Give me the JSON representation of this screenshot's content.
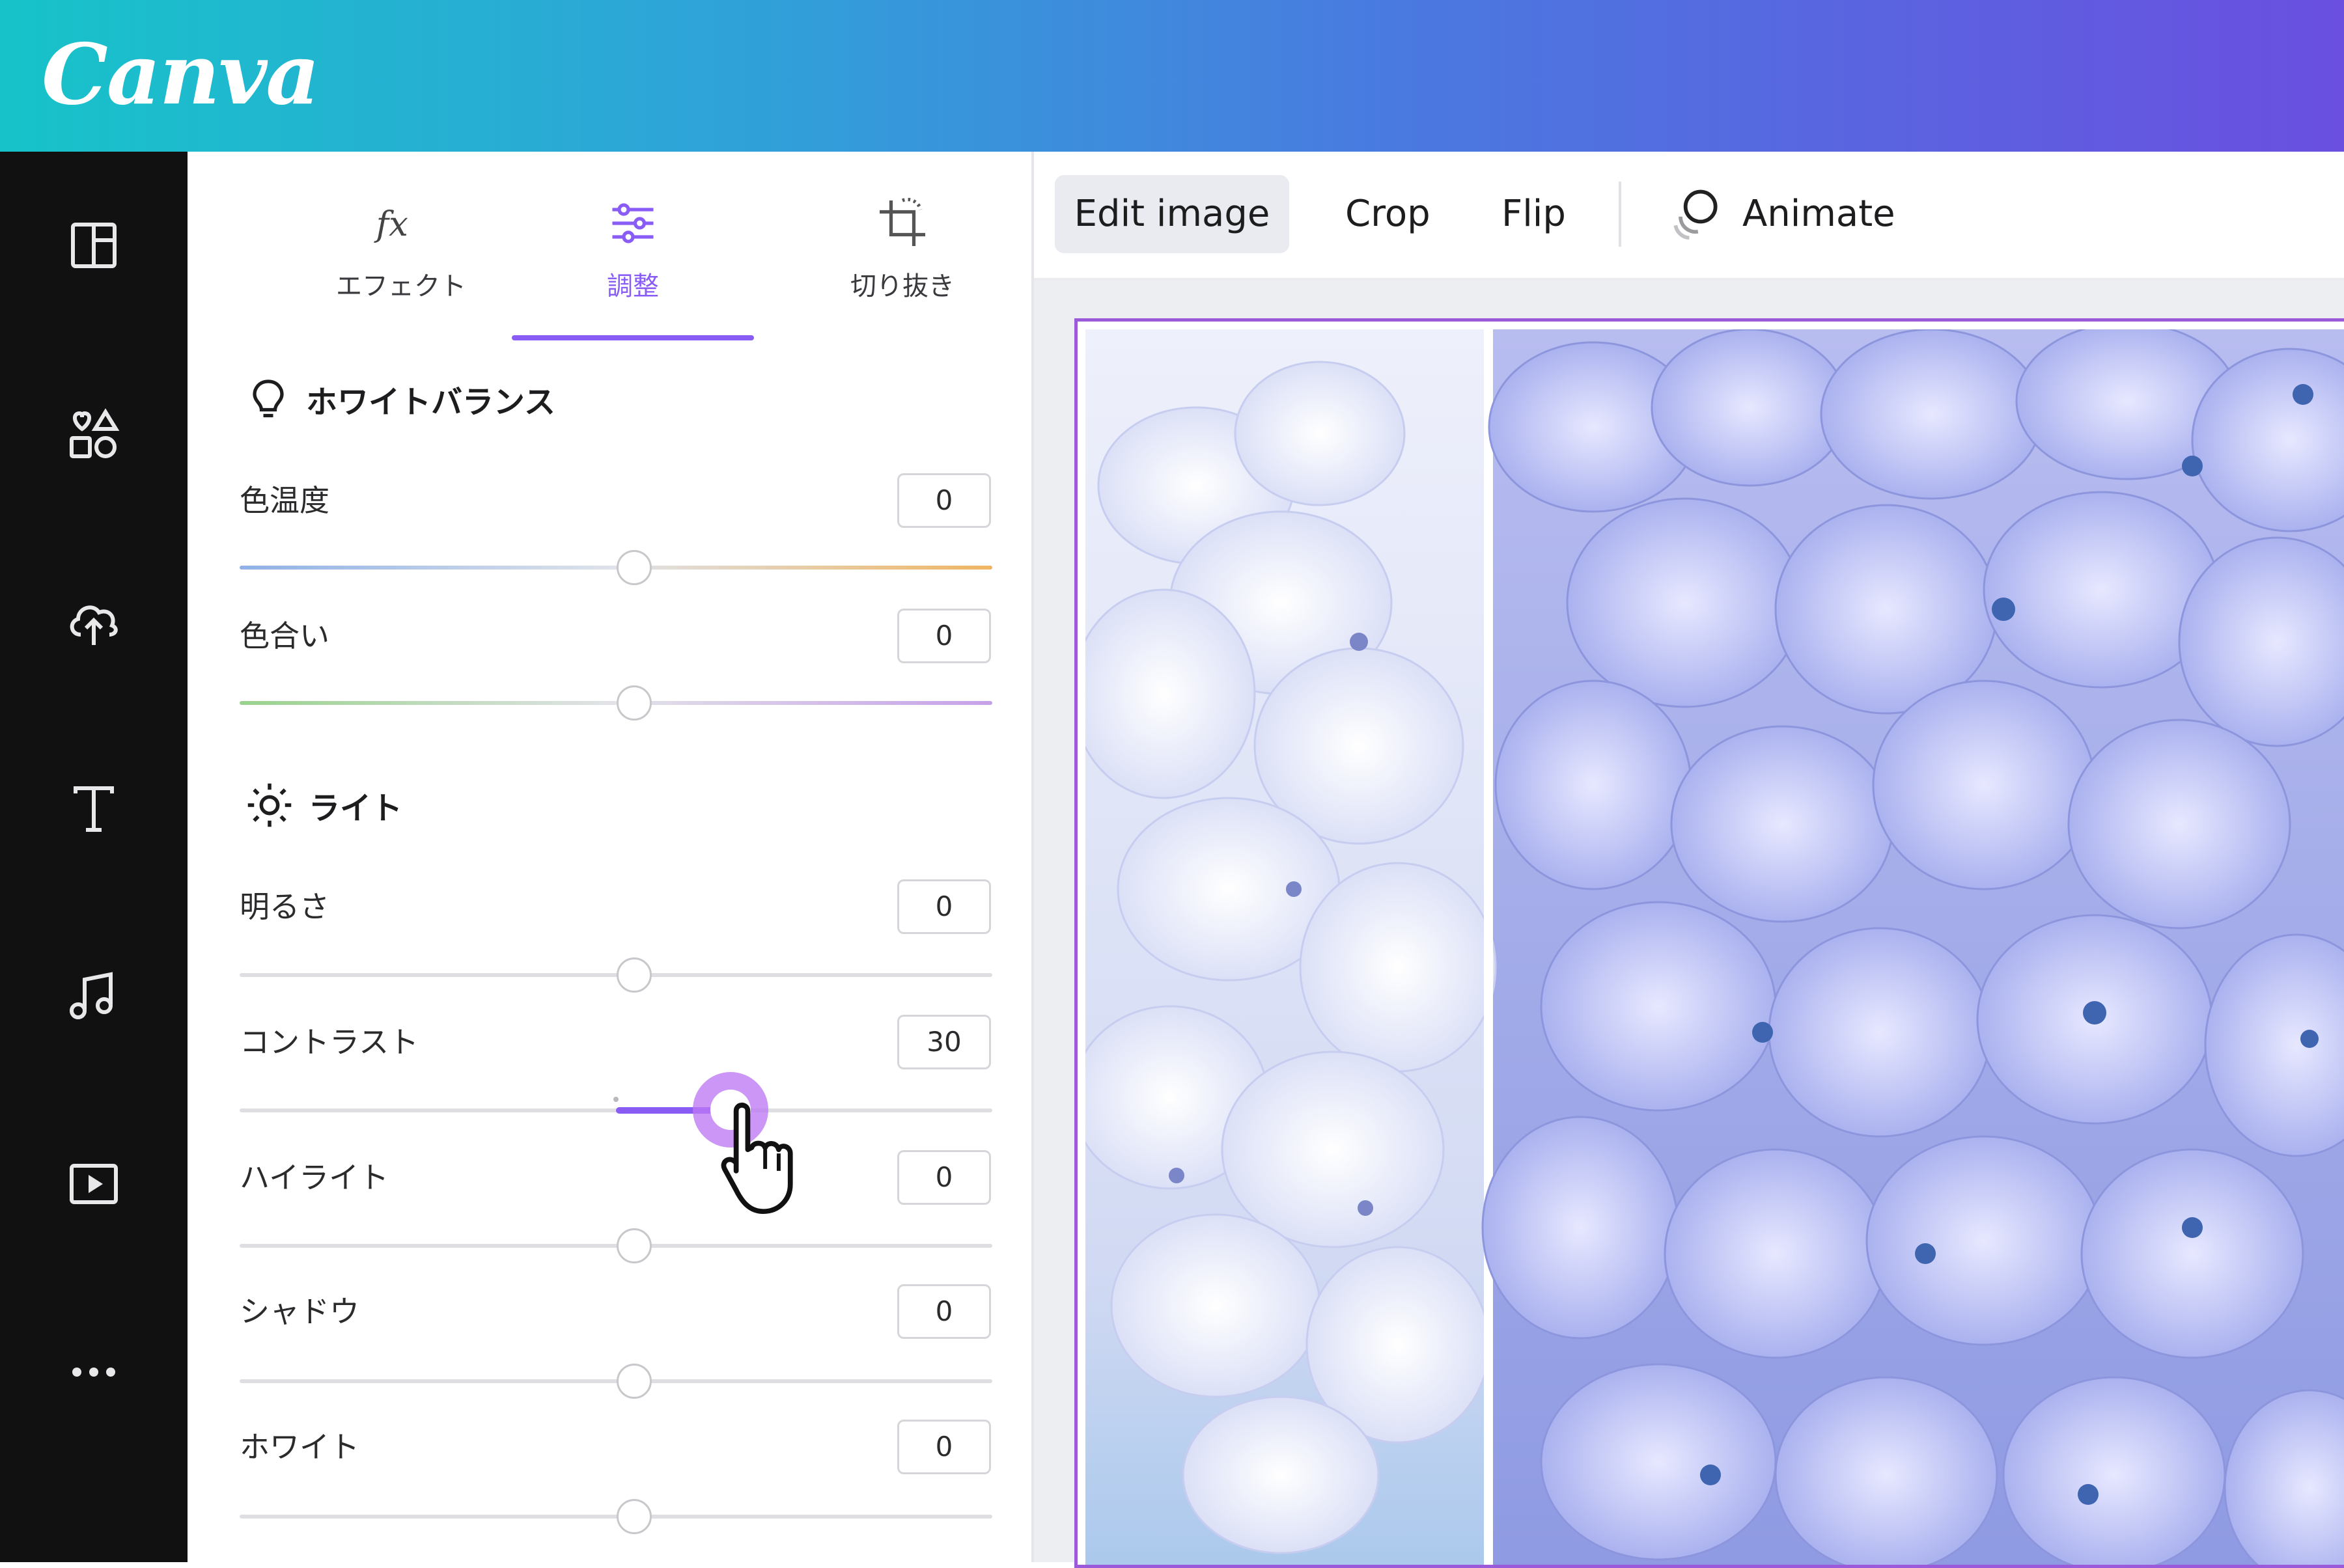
{
  "app": {
    "logo": "Canva"
  },
  "colors": {
    "accent": "#8a5cf6",
    "selection": "#9b5ad9",
    "rail": "#111112"
  },
  "sidebar": {
    "items": [
      {
        "icon": "layout-icon"
      },
      {
        "icon": "elements-icon"
      },
      {
        "icon": "upload-icon"
      },
      {
        "icon": "text-icon"
      },
      {
        "icon": "music-icon"
      },
      {
        "icon": "video-icon"
      },
      {
        "icon": "more-icon"
      }
    ]
  },
  "panel": {
    "tabs": [
      {
        "label": "エフェクト",
        "icon": "fx-icon"
      },
      {
        "label": "調整",
        "icon": "sliders-icon",
        "active": true
      },
      {
        "label": "切り抜き",
        "icon": "crop-icon"
      }
    ],
    "sections": {
      "white_balance": {
        "title": "ホワイトバランス",
        "icon": "bulb-icon"
      },
      "light": {
        "title": "ライト",
        "icon": "sun-icon"
      }
    },
    "adjustments": [
      {
        "label": "色温度",
        "value": "0"
      },
      {
        "label": "色合い",
        "value": "0"
      },
      {
        "label": "明るさ",
        "value": "0"
      },
      {
        "label": "コントラスト",
        "value": "30"
      },
      {
        "label": "ハイライト",
        "value": "0"
      },
      {
        "label": "シャドウ",
        "value": "0"
      },
      {
        "label": "ホワイト",
        "value": "0"
      }
    ]
  },
  "toolbar": {
    "edit_image": "Edit image",
    "crop": "Crop",
    "flip": "Flip",
    "animate": "Animate"
  }
}
